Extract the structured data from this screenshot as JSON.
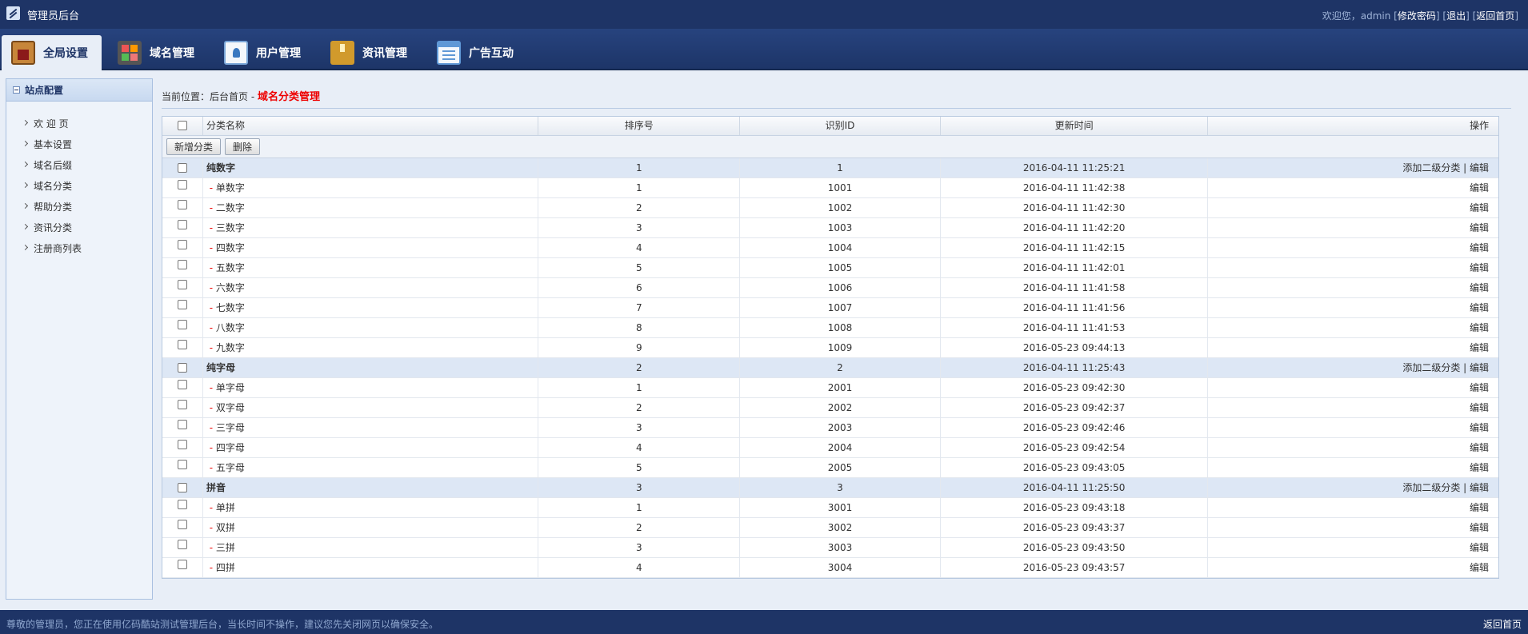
{
  "header": {
    "title": "管理员后台",
    "welcome": "欢迎您，",
    "username": "admin",
    "change_password": "修改密码",
    "logout": "退出",
    "home": "返回首页"
  },
  "nav": [
    {
      "label": "全局设置",
      "icon": "global-settings-icon",
      "active": true
    },
    {
      "label": "域名管理",
      "icon": "domain-icon"
    },
    {
      "label": "用户管理",
      "icon": "user-icon"
    },
    {
      "label": "资讯管理",
      "icon": "news-icon"
    },
    {
      "label": "广告互动",
      "icon": "ad-icon"
    }
  ],
  "sidebar": {
    "title": "站点配置",
    "items": [
      "欢 迎 页",
      "基本设置",
      "域名后缀",
      "域名分类",
      "帮助分类",
      "资讯分类",
      "注册商列表"
    ]
  },
  "breadcrumb": {
    "prefix": "当前位置：",
    "home": "后台首页",
    "separator": " - ",
    "current": "域名分类管理"
  },
  "table": {
    "columns": {
      "name": "分类名称",
      "sort": "排序号",
      "id": "识别ID",
      "time": "更新时间",
      "op": "操作"
    },
    "toolbar": {
      "add": "新增分类",
      "delete": "删除"
    },
    "ops": {
      "add_child": "添加二级分类",
      "sep": " | ",
      "edit": "编辑"
    },
    "rows": [
      {
        "level": "parent",
        "name": "纯数字",
        "sort": "1",
        "id": "1",
        "time": "2016-04-11 11:25:21"
      },
      {
        "level": "child",
        "name": "单数字",
        "sort": "1",
        "id": "1001",
        "time": "2016-04-11 11:42:38"
      },
      {
        "level": "child",
        "name": "二数字",
        "sort": "2",
        "id": "1002",
        "time": "2016-04-11 11:42:30"
      },
      {
        "level": "child",
        "name": "三数字",
        "sort": "3",
        "id": "1003",
        "time": "2016-04-11 11:42:20"
      },
      {
        "level": "child",
        "name": "四数字",
        "sort": "4",
        "id": "1004",
        "time": "2016-04-11 11:42:15"
      },
      {
        "level": "child",
        "name": "五数字",
        "sort": "5",
        "id": "1005",
        "time": "2016-04-11 11:42:01"
      },
      {
        "level": "child",
        "name": "六数字",
        "sort": "6",
        "id": "1006",
        "time": "2016-04-11 11:41:58"
      },
      {
        "level": "child",
        "name": "七数字",
        "sort": "7",
        "id": "1007",
        "time": "2016-04-11 11:41:56"
      },
      {
        "level": "child",
        "name": "八数字",
        "sort": "8",
        "id": "1008",
        "time": "2016-04-11 11:41:53"
      },
      {
        "level": "child",
        "name": "九数字",
        "sort": "9",
        "id": "1009",
        "time": "2016-05-23 09:44:13"
      },
      {
        "level": "parent",
        "name": "纯字母",
        "sort": "2",
        "id": "2",
        "time": "2016-04-11 11:25:43"
      },
      {
        "level": "child",
        "name": "单字母",
        "sort": "1",
        "id": "2001",
        "time": "2016-05-23 09:42:30"
      },
      {
        "level": "child",
        "name": "双字母",
        "sort": "2",
        "id": "2002",
        "time": "2016-05-23 09:42:37"
      },
      {
        "level": "child",
        "name": "三字母",
        "sort": "3",
        "id": "2003",
        "time": "2016-05-23 09:42:46"
      },
      {
        "level": "child",
        "name": "四字母",
        "sort": "4",
        "id": "2004",
        "time": "2016-05-23 09:42:54"
      },
      {
        "level": "child",
        "name": "五字母",
        "sort": "5",
        "id": "2005",
        "time": "2016-05-23 09:43:05"
      },
      {
        "level": "parent",
        "name": "拼音",
        "sort": "3",
        "id": "3",
        "time": "2016-04-11 11:25:50"
      },
      {
        "level": "child",
        "name": "单拼",
        "sort": "1",
        "id": "3001",
        "time": "2016-05-23 09:43:18"
      },
      {
        "level": "child",
        "name": "双拼",
        "sort": "2",
        "id": "3002",
        "time": "2016-05-23 09:43:37"
      },
      {
        "level": "child",
        "name": "三拼",
        "sort": "3",
        "id": "3003",
        "time": "2016-05-23 09:43:50"
      },
      {
        "level": "child",
        "name": "四拼",
        "sort": "4",
        "id": "3004",
        "time": "2016-05-23 09:43:57"
      }
    ]
  },
  "footer": {
    "message": "尊敬的管理员，您正在使用亿码酷站测试管理后台，当长时间不操作，建议您先关闭网页以确保安全。",
    "home": "返回首页"
  }
}
